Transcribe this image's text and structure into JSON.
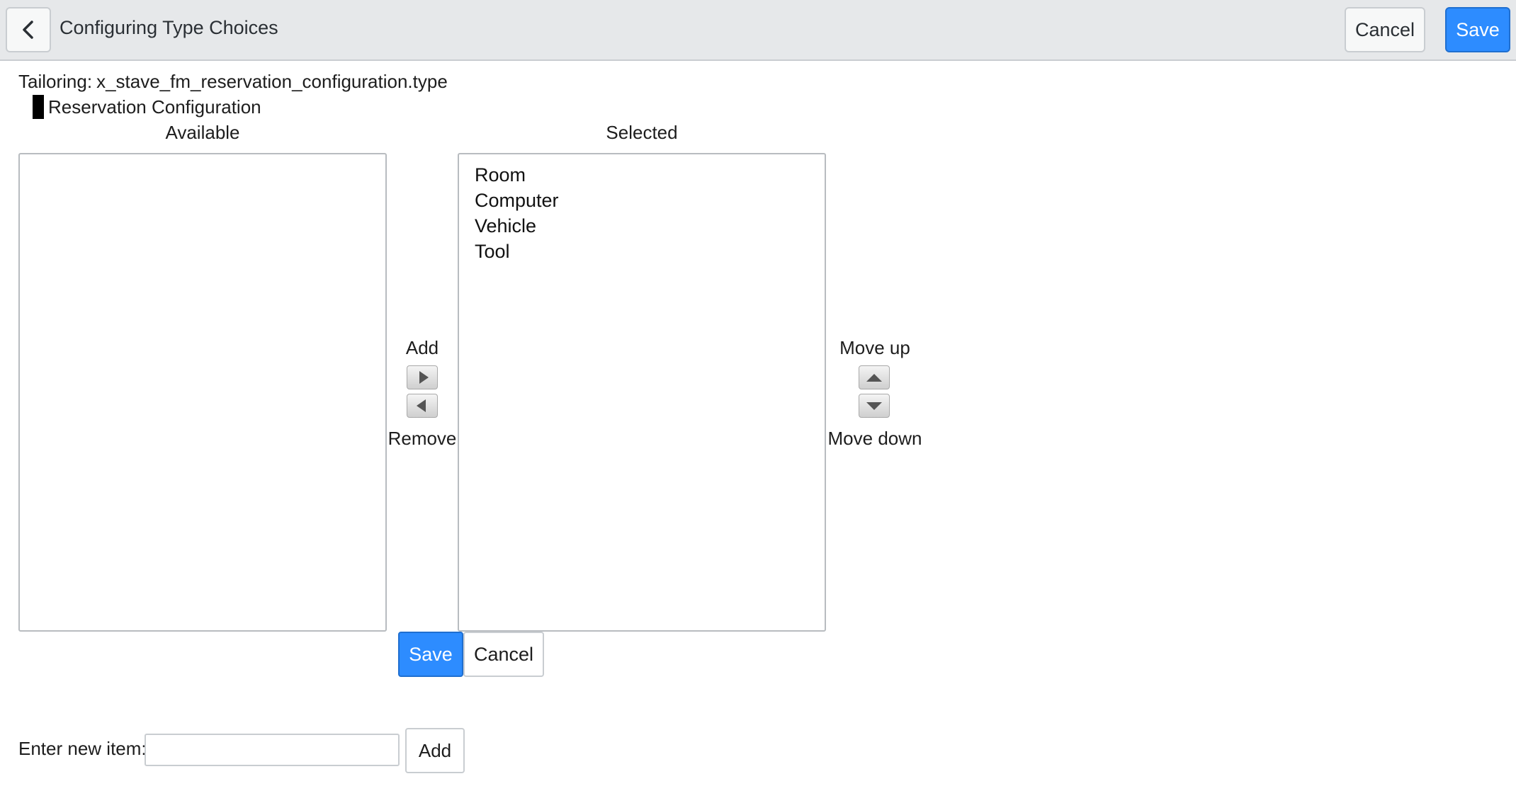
{
  "header": {
    "back_icon": "chevron-left-icon",
    "title": "Configuring Type Choices",
    "cancel_label": "Cancel",
    "save_label": "Save",
    "accent_color": "#2d8cff"
  },
  "tailoring": {
    "label": "Tailoring:",
    "value": "x_stave_fm_reservation_configuration.type"
  },
  "table_name": "Reservation Configuration",
  "available": {
    "heading": "Available",
    "items": []
  },
  "selected": {
    "heading": "Selected",
    "items": [
      "Room",
      "Computer",
      "Vehicle",
      "Tool"
    ]
  },
  "controls": {
    "add_label": "Add",
    "remove_label": "Remove",
    "move_up_label": "Move up",
    "move_down_label": "Move down"
  },
  "form_buttons": {
    "save_label": "Save",
    "cancel_label": "Cancel"
  },
  "new_item": {
    "label": "Enter new item:",
    "value": "",
    "add_label": "Add"
  }
}
